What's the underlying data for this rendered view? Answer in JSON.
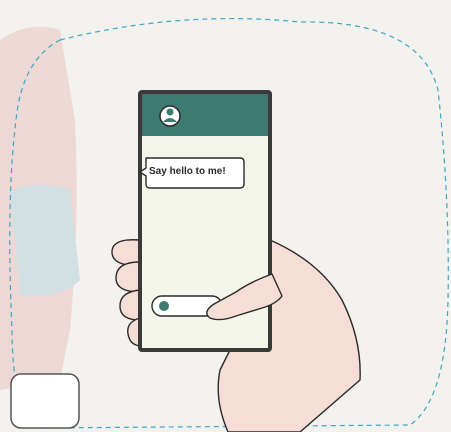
{
  "chat_bubble": {
    "text": "Say hello to me!"
  },
  "colors": {
    "header_teal": "#3e7a72",
    "frame_dark": "#3a3a3a",
    "screen_bg": "#f4f6e9",
    "skin": "#f6ddd6",
    "dashed_outline": "#3fa7c4",
    "send_dot": "#3e7a72"
  },
  "icons": {
    "avatar": "user-avatar-icon",
    "send": "send-dot-icon"
  }
}
